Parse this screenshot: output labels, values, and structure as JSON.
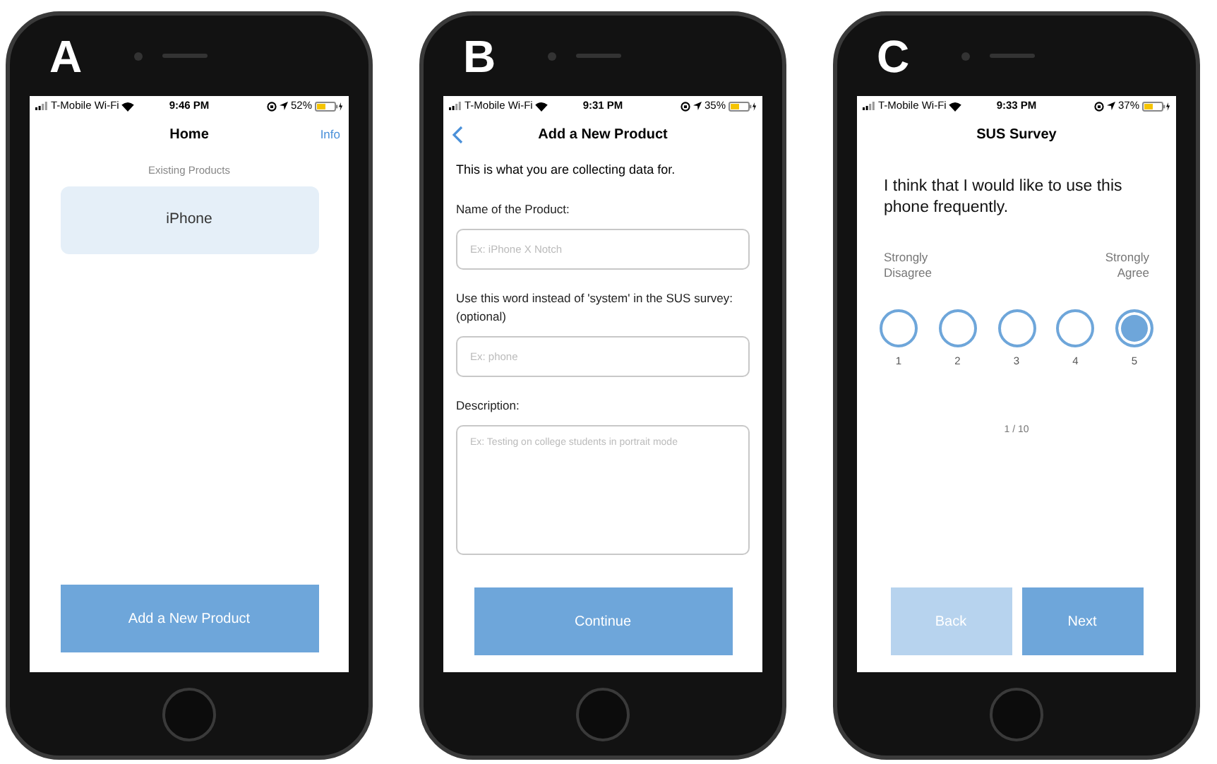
{
  "panels": [
    {
      "label": "A",
      "kind": "home",
      "status_bar": {
        "carrier": "T-Mobile Wi-Fi",
        "time": "9:46 PM",
        "battery": "52%"
      },
      "title": "Home",
      "nav_action": "Info",
      "section_label": "Existing Products",
      "products": [
        "iPhone"
      ],
      "button": "Add a New Product"
    },
    {
      "label": "B",
      "kind": "form",
      "status_bar": {
        "carrier": "T-Mobile Wi-Fi",
        "time": "9:31 PM",
        "battery": "35%"
      },
      "title": "Add a New Product",
      "intro": "This is what you are collecting data for.",
      "fields": [
        {
          "label": "Name of the Product:",
          "placeholder": "Ex: iPhone X Notch",
          "kind": "input"
        },
        {
          "label": "Use this word instead of 'system' in the SUS survey: (optional)",
          "placeholder": "Ex: phone",
          "kind": "input"
        },
        {
          "label": "Description:",
          "placeholder": "Ex: Testing on college students in portrait mode",
          "kind": "textarea"
        }
      ],
      "button": "Continue"
    },
    {
      "label": "C",
      "kind": "survey",
      "status_bar": {
        "carrier": "T-Mobile Wi-Fi",
        "time": "9:33 PM",
        "battery": "37%"
      },
      "title": "SUS Survey",
      "question": "I think that I would like to use this phone frequently.",
      "scale_left": "Strongly Disagree",
      "scale_right": "Strongly Agree",
      "options": [
        {
          "label": "1",
          "selected": false
        },
        {
          "label": "2",
          "selected": false
        },
        {
          "label": "3",
          "selected": false
        },
        {
          "label": "4",
          "selected": false
        },
        {
          "label": "5",
          "selected": true
        }
      ],
      "progress": "1 / 10",
      "buttons": [
        {
          "label": "Back",
          "disabled": true
        },
        {
          "label": "Next",
          "disabled": false
        }
      ]
    }
  ]
}
